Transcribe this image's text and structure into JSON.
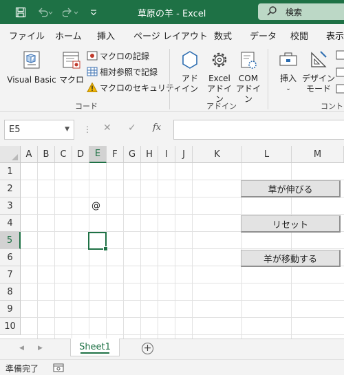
{
  "titlebar": {
    "title": "草原の羊  -  Excel",
    "search_label": "検索",
    "icons": [
      "save-icon",
      "undo-icon",
      "redo-icon",
      "customize-qat-icon",
      "search-icon"
    ]
  },
  "ribbon_tabs": [
    "ファイル",
    "ホーム",
    "挿入",
    "ページ レイアウト",
    "数式",
    "データ",
    "校閲",
    "表示"
  ],
  "ribbon": {
    "code_group": {
      "label": "コード",
      "visual_basic": "Visual Basic",
      "macro": "マクロ",
      "record_macro": "マクロの記録",
      "relative_ref": "相対参照で記録",
      "macro_security": "マクロのセキュリティ"
    },
    "addin_group": {
      "label": "アドイン",
      "addin_line1": "アド",
      "addin_line2": "イン",
      "excel_addin_line1": "Excel",
      "excel_addin_line2": "アドイン",
      "com_addin_line1": "COM",
      "com_addin_line2": "アドイン"
    },
    "controls_group": {
      "label": "コントロ",
      "insert": "挿入",
      "design_line1": "デザイン",
      "design_line2": "モード"
    }
  },
  "formula_bar": {
    "name_box": "E5",
    "cancel": "✕",
    "enter": "✓",
    "fx": "fx",
    "value": ""
  },
  "grid": {
    "columns": [
      "A",
      "B",
      "C",
      "D",
      "E",
      "F",
      "G",
      "H",
      "I",
      "J",
      "K",
      "L",
      "M"
    ],
    "rows": [
      "1",
      "2",
      "3",
      "4",
      "5",
      "6",
      "7",
      "8",
      "9",
      "10"
    ],
    "selected_cell": "E5",
    "cell_E3": "@"
  },
  "form_buttons": {
    "grow": "草が伸びる",
    "reset": "リセット",
    "move": "羊が移動する"
  },
  "sheets": {
    "active": "Sheet1"
  },
  "status": {
    "text": "準備完了"
  },
  "colors": {
    "excel_green": "#1e7145",
    "search_box": "#bcd8c6"
  }
}
